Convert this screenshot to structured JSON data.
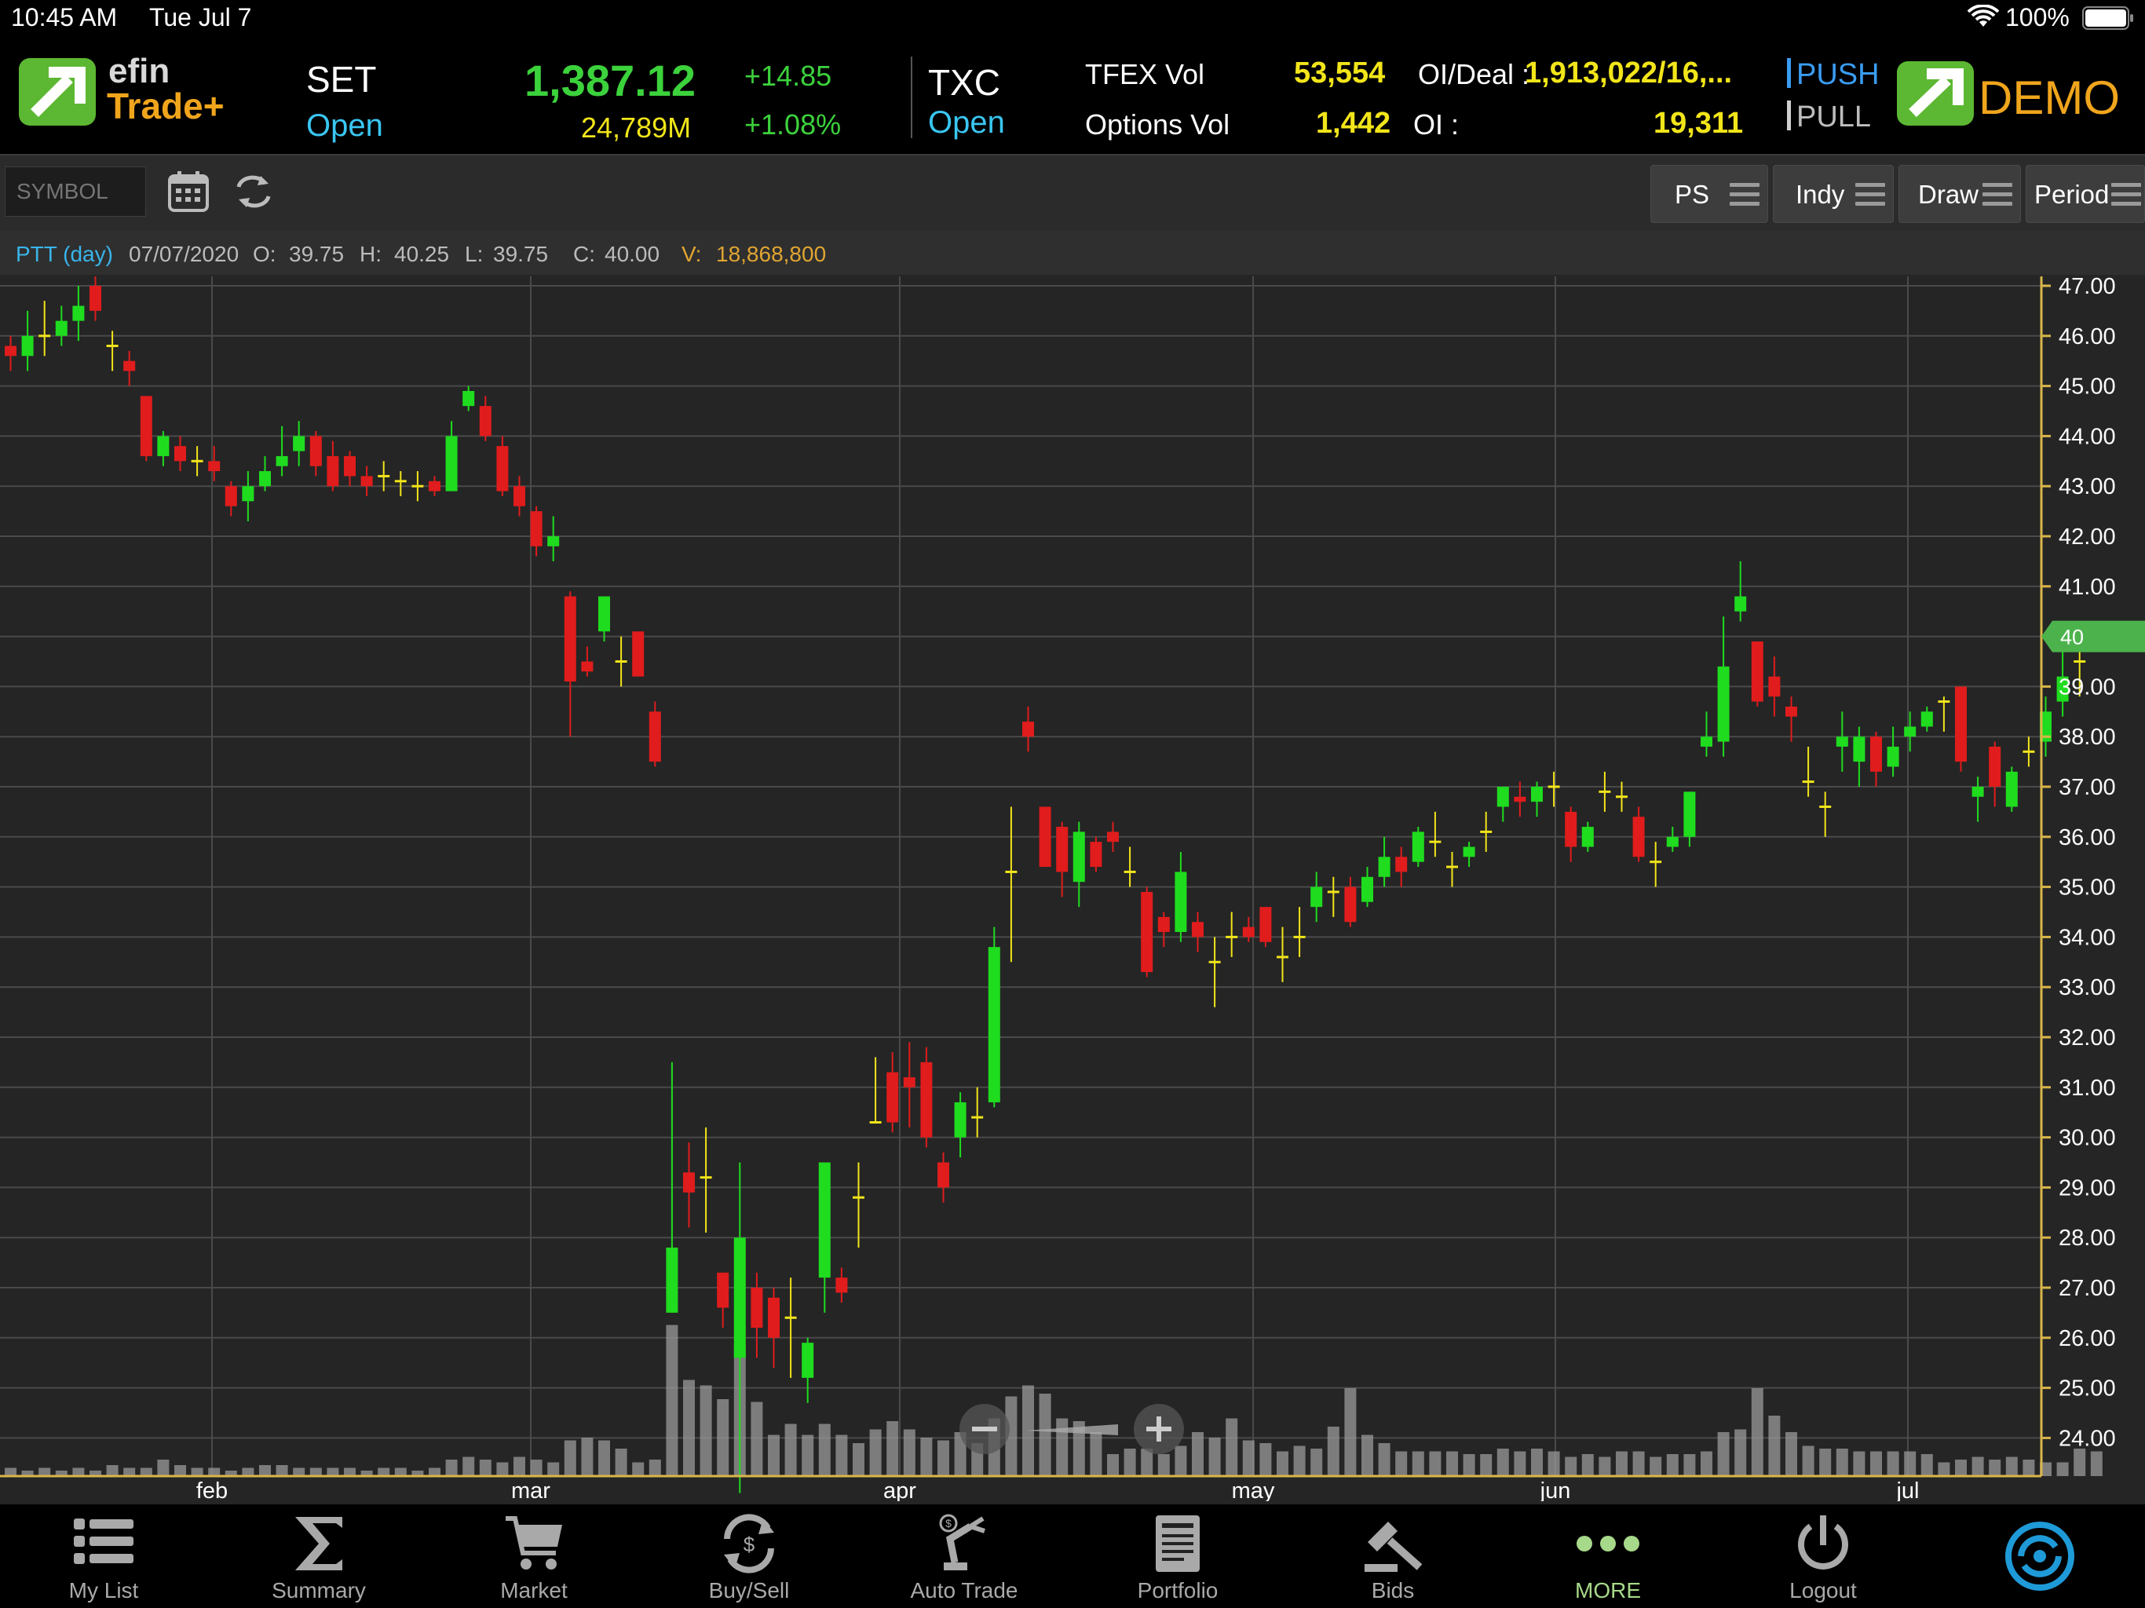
{
  "status_bar": {
    "time": "10:45 AM",
    "date": "Tue Jul 7",
    "battery": "100%"
  },
  "header": {
    "logo_line1": "efin",
    "logo_line2": "Trade+",
    "set": {
      "name": "SET",
      "status": "Open",
      "index": "1,387.12",
      "value": "24,789M",
      "change": "+14.85",
      "change_pct": "+1.08%"
    },
    "txc": {
      "name": "TXC",
      "status": "Open"
    },
    "tfex": {
      "vol_label": "TFEX Vol",
      "vol_value": "53,554",
      "oi_deal_label": "OI/Deal :",
      "oi_deal_value": "1,913,022/16,...",
      "options_label": "Options Vol",
      "options_value": "1,442",
      "oi_label": "OI :",
      "oi_value": "19,311"
    },
    "push_label": "PUSH",
    "pull_label": "PULL",
    "mode": "DEMO"
  },
  "toolbar": {
    "symbol_placeholder": "SYMBOL",
    "buttons": [
      "PS",
      "Indy",
      "Draw",
      "Period"
    ]
  },
  "info": {
    "symbol": "PTT (day)",
    "date": "07/07/2020",
    "o_label": "O:",
    "o": "39.75",
    "h_label": "H:",
    "h": "40.25",
    "l_label": "L:",
    "l": "39.75",
    "c_label": "C:",
    "c": "40.00",
    "v_label": "V:",
    "v": "18,868,800"
  },
  "chart_data": {
    "type": "candlestick",
    "symbol": "PTT",
    "y_ticks": [
      "47.00",
      "46.00",
      "45.00",
      "44.00",
      "43.00",
      "42.00",
      "41.00",
      "40.00",
      "39.00",
      "38.00",
      "37.00",
      "36.00",
      "35.00",
      "34.00",
      "33.00",
      "32.00",
      "31.00",
      "30.00",
      "29.00",
      "28.00",
      "27.00",
      "26.00",
      "25.00",
      "24.00"
    ],
    "ylim": [
      23.5,
      47.2
    ],
    "current_price_label": "40",
    "x_labels": [
      "feb",
      "mar",
      "apr",
      "may",
      "jun",
      "jul"
    ],
    "candles": [
      [
        45.8,
        45.6,
        46.0,
        45.3
      ],
      [
        45.6,
        46.0,
        46.5,
        45.3
      ],
      [
        46.0,
        46.0,
        46.7,
        45.6
      ],
      [
        46.0,
        46.3,
        46.6,
        45.8
      ],
      [
        46.3,
        46.6,
        47.0,
        45.9
      ],
      [
        47.0,
        46.5,
        47.2,
        46.3
      ],
      [
        45.8,
        45.8,
        46.1,
        45.3
      ],
      [
        45.5,
        45.3,
        45.7,
        45.0
      ],
      [
        44.8,
        43.6,
        44.8,
        43.5
      ],
      [
        43.6,
        44.0,
        44.1,
        43.4
      ],
      [
        43.8,
        43.5,
        44.0,
        43.3
      ],
      [
        43.5,
        43.5,
        43.8,
        43.2
      ],
      [
        43.5,
        43.3,
        43.8,
        43.1
      ],
      [
        43.0,
        42.6,
        43.1,
        42.4
      ],
      [
        42.7,
        43.0,
        43.3,
        42.3
      ],
      [
        43.0,
        43.3,
        43.6,
        42.9
      ],
      [
        43.4,
        43.6,
        44.2,
        43.2
      ],
      [
        43.7,
        44.0,
        44.3,
        43.4
      ],
      [
        44.0,
        43.4,
        44.1,
        43.2
      ],
      [
        43.6,
        43.0,
        43.9,
        42.9
      ],
      [
        43.6,
        43.2,
        43.7,
        43.0
      ],
      [
        43.2,
        43.0,
        43.4,
        42.8
      ],
      [
        43.2,
        43.2,
        43.5,
        42.9
      ],
      [
        43.1,
        43.1,
        43.3,
        42.8
      ],
      [
        43.0,
        43.0,
        43.3,
        42.7
      ],
      [
        43.1,
        42.9,
        43.2,
        42.8
      ],
      [
        42.9,
        44.0,
        44.3,
        42.9
      ],
      [
        44.6,
        44.9,
        45.0,
        44.5
      ],
      [
        44.6,
        44.0,
        44.8,
        43.9
      ],
      [
        43.8,
        42.9,
        44.0,
        42.8
      ],
      [
        43.0,
        42.6,
        43.2,
        42.4
      ],
      [
        42.5,
        41.8,
        42.6,
        41.6
      ],
      [
        41.8,
        42.0,
        42.4,
        41.5
      ],
      [
        40.8,
        39.1,
        40.9,
        38.0
      ],
      [
        39.5,
        39.3,
        39.8,
        39.2
      ],
      [
        40.1,
        40.8,
        40.8,
        39.9
      ],
      [
        39.5,
        39.5,
        40.0,
        39.0
      ],
      [
        40.1,
        39.2,
        40.1,
        39.2
      ],
      [
        38.5,
        37.5,
        38.7,
        37.4
      ],
      [
        26.5,
        27.8,
        31.5,
        26.5
      ],
      [
        29.3,
        28.9,
        29.9,
        28.2
      ],
      [
        29.2,
        29.2,
        30.2,
        28.1
      ],
      [
        27.3,
        26.6,
        27.3,
        26.2
      ],
      [
        25.6,
        28.0,
        29.5,
        22.9
      ],
      [
        27.0,
        26.2,
        27.3,
        25.6
      ],
      [
        26.8,
        26.0,
        27.0,
        25.4
      ],
      [
        26.4,
        26.4,
        27.2,
        25.2
      ],
      [
        25.2,
        25.9,
        26.0,
        24.7
      ],
      [
        27.2,
        29.5,
        29.5,
        26.5
      ],
      [
        27.2,
        26.9,
        27.4,
        26.7
      ],
      [
        28.8,
        28.8,
        29.5,
        27.8
      ],
      [
        30.3,
        30.3,
        31.6,
        30.3
      ],
      [
        31.3,
        30.3,
        31.7,
        30.1
      ],
      [
        31.2,
        31.0,
        31.9,
        30.2
      ],
      [
        31.5,
        30.0,
        31.8,
        29.8
      ],
      [
        29.5,
        29.0,
        29.7,
        28.7
      ],
      [
        30.0,
        30.7,
        30.9,
        29.6
      ],
      [
        30.4,
        30.4,
        31.0,
        30.0
      ],
      [
        30.7,
        33.8,
        34.2,
        30.6
      ],
      [
        35.3,
        35.3,
        36.6,
        33.5
      ],
      [
        38.3,
        38.0,
        38.6,
        37.7
      ],
      [
        36.6,
        35.4,
        36.6,
        35.4
      ],
      [
        36.2,
        35.3,
        36.3,
        34.8
      ],
      [
        35.1,
        36.1,
        36.3,
        34.6
      ],
      [
        35.9,
        35.4,
        36.0,
        35.3
      ],
      [
        36.1,
        35.9,
        36.3,
        35.7
      ],
      [
        35.3,
        35.3,
        35.8,
        35.0
      ],
      [
        34.9,
        33.3,
        35.0,
        33.2
      ],
      [
        34.4,
        34.1,
        34.5,
        33.8
      ],
      [
        34.1,
        35.3,
        35.7,
        33.9
      ],
      [
        34.3,
        34.0,
        34.5,
        33.7
      ],
      [
        33.5,
        33.5,
        34.0,
        32.6
      ],
      [
        34.0,
        34.0,
        34.5,
        33.6
      ],
      [
        34.2,
        34.0,
        34.4,
        33.9
      ],
      [
        34.6,
        33.9,
        34.6,
        33.8
      ],
      [
        33.6,
        33.6,
        34.2,
        33.1
      ],
      [
        34.0,
        34.0,
        34.6,
        33.6
      ],
      [
        34.6,
        35.0,
        35.3,
        34.3
      ],
      [
        34.9,
        34.9,
        35.2,
        34.4
      ],
      [
        35.0,
        34.3,
        35.2,
        34.2
      ],
      [
        34.7,
        35.2,
        35.4,
        34.6
      ],
      [
        35.2,
        35.6,
        36.0,
        35.0
      ],
      [
        35.6,
        35.3,
        35.8,
        35.0
      ],
      [
        35.5,
        36.1,
        36.2,
        35.4
      ],
      [
        35.9,
        35.9,
        36.5,
        35.6
      ],
      [
        35.4,
        35.4,
        35.7,
        35.0
      ],
      [
        35.6,
        35.8,
        35.9,
        35.4
      ],
      [
        36.1,
        36.1,
        36.5,
        35.7
      ],
      [
        36.6,
        37.0,
        37.0,
        36.3
      ],
      [
        36.8,
        36.7,
        37.1,
        36.4
      ],
      [
        36.7,
        37.0,
        37.1,
        36.4
      ],
      [
        37.0,
        37.0,
        37.3,
        36.6
      ],
      [
        36.5,
        35.8,
        36.6,
        35.5
      ],
      [
        35.8,
        36.2,
        36.3,
        35.7
      ],
      [
        36.9,
        36.9,
        37.3,
        36.5
      ],
      [
        36.8,
        36.8,
        37.1,
        36.5
      ],
      [
        36.4,
        35.6,
        36.6,
        35.5
      ],
      [
        35.5,
        35.5,
        35.9,
        35.0
      ],
      [
        35.8,
        36.0,
        36.2,
        35.7
      ],
      [
        36.0,
        36.9,
        36.9,
        35.8
      ],
      [
        37.8,
        38.0,
        38.5,
        37.6
      ],
      [
        37.9,
        39.4,
        40.4,
        37.6
      ],
      [
        40.5,
        40.8,
        41.5,
        40.3
      ],
      [
        39.9,
        38.7,
        39.9,
        38.6
      ],
      [
        39.2,
        38.8,
        39.6,
        38.4
      ],
      [
        38.6,
        38.4,
        38.8,
        37.9
      ],
      [
        37.1,
        37.1,
        37.8,
        36.8
      ],
      [
        36.6,
        36.6,
        36.9,
        36.0
      ],
      [
        37.8,
        38.0,
        38.5,
        37.3
      ],
      [
        37.5,
        38.0,
        38.2,
        37.0
      ],
      [
        38.0,
        37.3,
        38.1,
        37.0
      ],
      [
        37.4,
        37.8,
        38.2,
        37.2
      ],
      [
        38.0,
        38.2,
        38.5,
        37.7
      ],
      [
        38.2,
        38.5,
        38.6,
        38.1
      ],
      [
        38.7,
        38.7,
        38.8,
        38.1
      ],
      [
        39.0,
        37.5,
        39.0,
        37.3
      ],
      [
        36.8,
        37.0,
        37.2,
        36.3
      ],
      [
        37.8,
        37.0,
        37.9,
        36.6
      ],
      [
        36.6,
        37.3,
        37.4,
        36.5
      ],
      [
        37.7,
        37.7,
        38.0,
        37.4
      ],
      [
        37.9,
        38.5,
        38.8,
        37.6
      ],
      [
        38.7,
        39.2,
        39.8,
        38.4
      ],
      [
        39.5,
        39.5,
        39.8,
        38.8
      ],
      [
        39.75,
        40.0,
        40.25,
        39.75
      ]
    ],
    "volume": [
      3,
      2,
      3,
      2,
      3,
      2,
      4,
      3,
      3,
      6,
      4,
      3,
      3,
      2,
      3,
      4,
      4,
      3,
      3,
      3,
      3,
      2,
      3,
      3,
      2,
      3,
      6,
      7,
      6,
      5,
      7,
      6,
      5,
      13,
      14,
      13,
      10,
      5,
      6,
      55,
      35,
      33,
      28,
      48,
      27,
      15,
      19,
      15,
      19,
      15,
      12,
      17,
      20,
      17,
      14,
      13,
      16,
      12,
      21,
      29,
      33,
      30,
      21,
      20,
      16,
      8,
      10,
      10,
      8,
      11,
      16,
      14,
      21,
      13,
      12,
      9,
      11,
      10,
      18,
      32,
      15,
      12,
      9,
      9,
      9,
      9,
      8,
      8,
      10,
      9,
      10,
      9,
      7,
      8,
      7,
      9,
      9,
      7,
      8,
      8,
      9,
      16,
      17,
      32,
      22,
      16,
      11,
      10,
      10,
      9,
      9,
      9,
      9,
      8,
      5,
      6,
      7,
      6,
      7,
      6,
      5,
      5,
      10,
      9,
      5,
      3
    ]
  },
  "bottom_nav": [
    "My List",
    "Summary",
    "Market",
    "Buy/Sell",
    "Auto Trade",
    "Portfolio",
    "Bids",
    "MORE",
    "Logout"
  ],
  "colors": {
    "up": "#1fdc1f",
    "down": "#e01c1c",
    "flat": "#f2e51a",
    "grid": "#4a4a4a",
    "axis": "#d9b64a",
    "price_tag": "#4cb34c"
  }
}
